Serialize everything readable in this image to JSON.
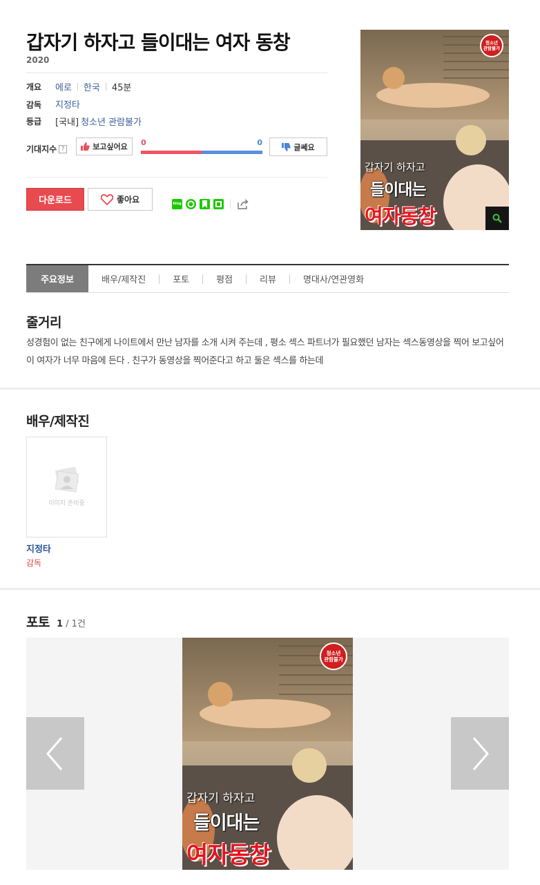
{
  "movie": {
    "title": "갑자기 하자고 들이대는 여자 동창",
    "year": "2020"
  },
  "info": {
    "overview_label": "개요",
    "genre": "에로",
    "country": "한국",
    "runtime": "45분",
    "director_label": "감독",
    "director": "지정타",
    "rating_label": "등급",
    "rating_prefix": "[국내]",
    "rating": "청소년 관람불가"
  },
  "expectation": {
    "label": "기대지수",
    "help": "?",
    "want_label": "보고싶어요",
    "meh_label": "글쎄요",
    "want_count": "0",
    "meh_count": "0",
    "want_ratio": 0.5
  },
  "actions": {
    "download_label": "다운로드",
    "like_label": "좋아요",
    "blog_label": "blog"
  },
  "poster": {
    "badge": "청소년\n관람불가",
    "subtitle": "갑자기 하자고",
    "line2": "들이대는",
    "line3": "여자동창"
  },
  "tabs": [
    {
      "label": "주요정보",
      "active": true
    },
    {
      "label": "배우/제작진"
    },
    {
      "label": "포토"
    },
    {
      "label": "평점"
    },
    {
      "label": "리뷰"
    },
    {
      "label": "명대사/연관영화"
    }
  ],
  "synopsis": {
    "heading": "줄거리",
    "text": "성경험이 없는 친구에게 나이트에서 만난 남자를 소개 시켜 주는데 , 평소 섹스 파트너가 필요했던 남자는 섹스동영상을 찍어 보고싶어 이 여자가 너무 마음에 든다 . 친구가 동영상을 찍어준다고 하고 둘은 섹스를 하는데"
  },
  "cast": {
    "heading": "배우/제작진",
    "no_image": "이미지 준비중",
    "members": [
      {
        "name": "지정타",
        "role": "감독"
      }
    ]
  },
  "photos": {
    "heading": "포토",
    "current": "1",
    "total": "/ 1건"
  },
  "colors": {
    "accent_red": "#e84a4f",
    "link_blue": "#3a5f9e",
    "bar_red": "#f05563",
    "bar_blue": "#5b8ee0",
    "naver_green": "#1ec800"
  }
}
